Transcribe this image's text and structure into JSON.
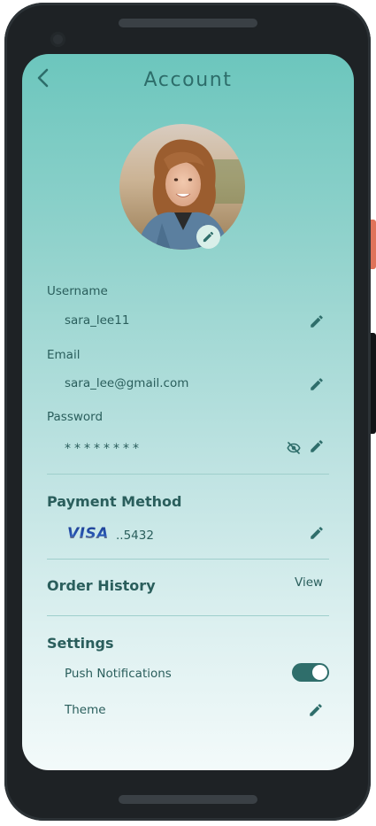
{
  "header": {
    "title": "Account",
    "back_icon": "chevron-left-icon"
  },
  "profile": {
    "avatar": "profile-photo",
    "edit_icon": "pencil-icon"
  },
  "fields": {
    "username_label": "Username",
    "username_value": "sara_lee11",
    "email_label": "Email",
    "email_value": "sara_lee@gmail.com",
    "password_label": "Password",
    "password_value": "********"
  },
  "payment": {
    "title": "Payment Method",
    "card_brand": "VISA",
    "card_number": "..5432"
  },
  "orders": {
    "title": "Order History",
    "view_label": "View"
  },
  "settings": {
    "title": "Settings",
    "push_label": "Push Notifications",
    "push_enabled": true,
    "theme_label": "Theme"
  },
  "colors": {
    "accent": "#2f6e6b",
    "text": "#2a5e5c",
    "gradient_top": "#6cc6bd",
    "gradient_bottom": "#f3fafa"
  }
}
